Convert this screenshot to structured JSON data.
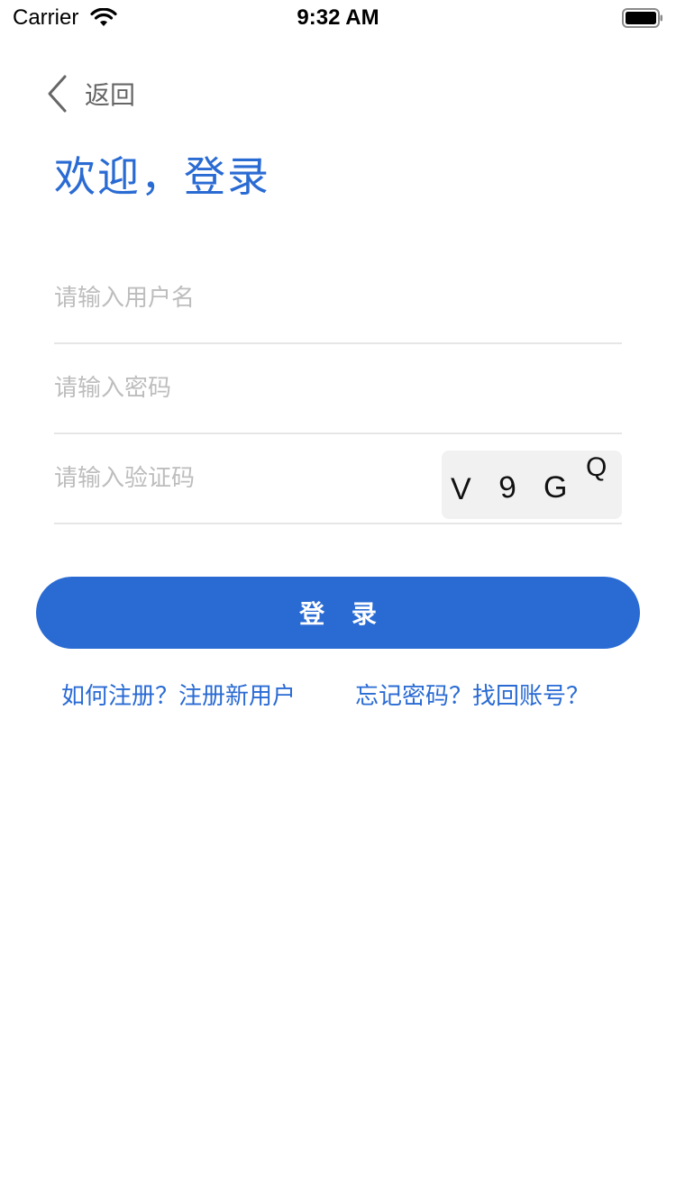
{
  "status_bar": {
    "carrier": "Carrier",
    "time": "9:32 AM",
    "icons": [
      "wifi-icon",
      "battery-icon"
    ]
  },
  "nav": {
    "back_label": "返回",
    "back_icon": "chevron-left-icon"
  },
  "title": "欢迎，登录",
  "form": {
    "username": {
      "value": "",
      "placeholder": "请输入用户名"
    },
    "password": {
      "value": "",
      "placeholder": "请输入密码"
    },
    "captcha": {
      "value": "",
      "placeholder": "请输入验证码"
    },
    "captcha_chars": [
      "V",
      "9",
      "G",
      "Q"
    ]
  },
  "login_button": "登 录",
  "links": {
    "register": "如何注册？注册新用户",
    "forgot": "忘记密码？找回账号？"
  },
  "colors": {
    "accent": "#2a6bd3",
    "placeholder": "#bdbdbd",
    "divider": "#e6e6e6",
    "captcha_bg": "#f1f1f1"
  }
}
